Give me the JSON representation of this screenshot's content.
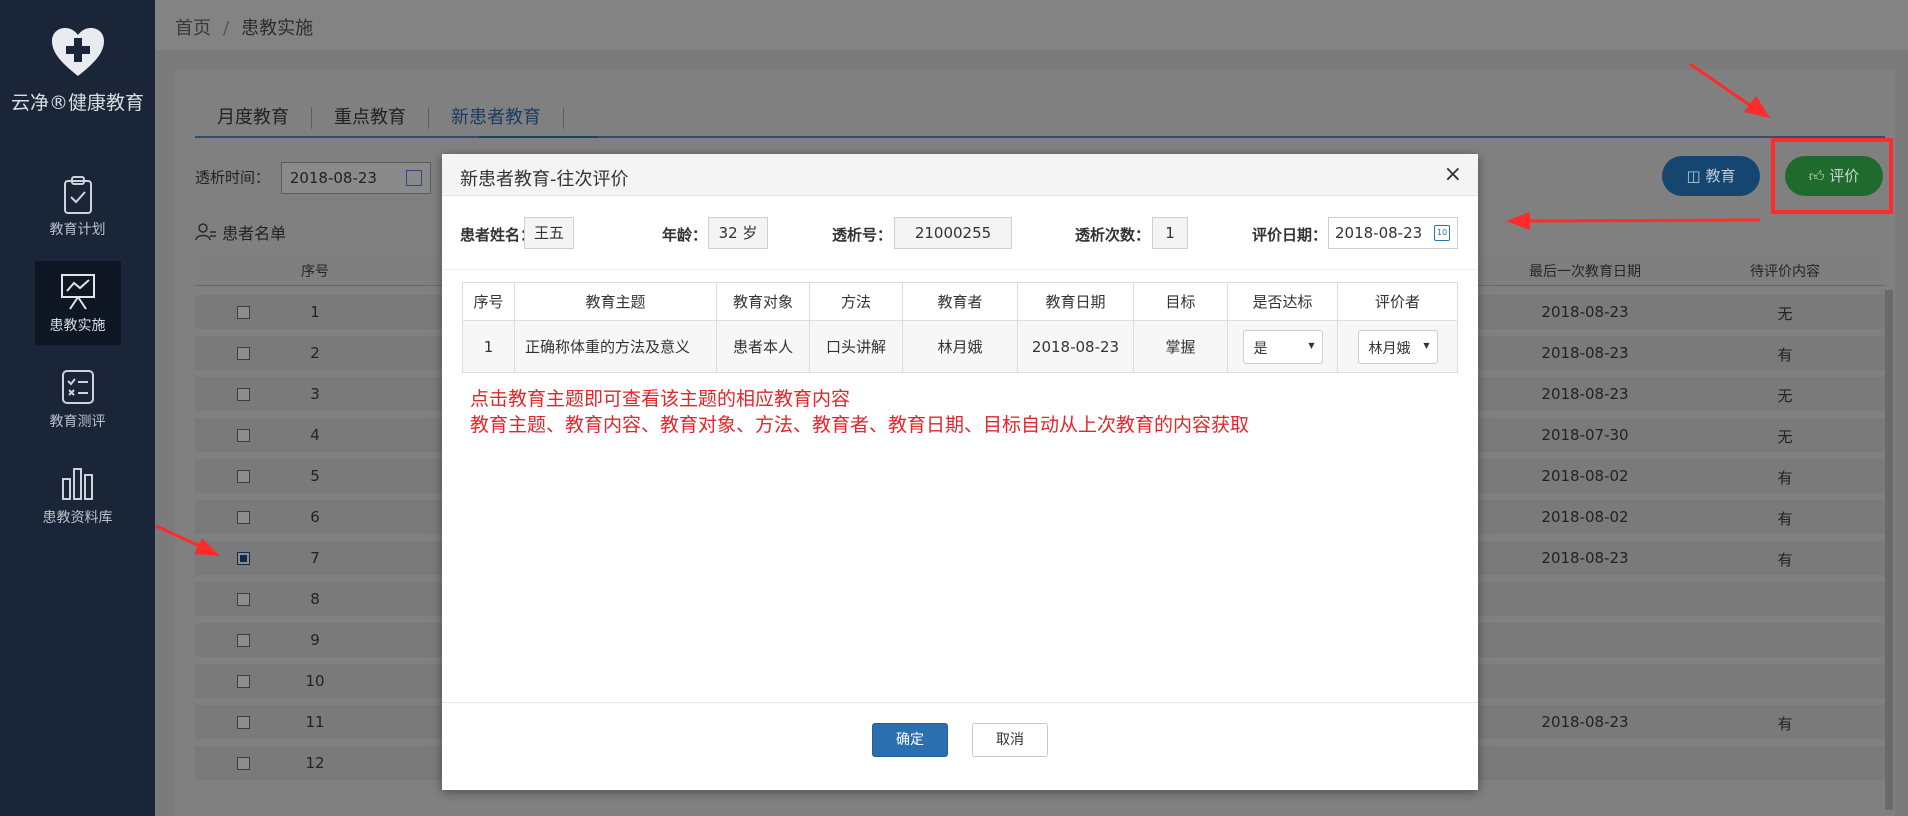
{
  "app": {
    "logo_text": "云净®健康教育"
  },
  "sidebar": {
    "items": [
      {
        "label": "教育计划",
        "icon": "clipboard-check-icon",
        "active": false
      },
      {
        "label": "患教实施",
        "icon": "presentation-board-icon",
        "active": true
      },
      {
        "label": "教育测评",
        "icon": "checklist-icon",
        "active": false
      },
      {
        "label": "患教资料库",
        "icon": "books-icon",
        "active": false
      }
    ]
  },
  "breadcrumb": {
    "home": "首页",
    "separator": "/",
    "current": "患教实施"
  },
  "tabs": [
    "月度教育",
    "重点教育",
    "新患者教育"
  ],
  "filter": {
    "label": "透析时间：",
    "date": "2018-08-23"
  },
  "list_title": "患者名单",
  "actions": {
    "edu_label": "教育",
    "eval_label": "评价"
  },
  "table": {
    "headers": {
      "seq": "序号",
      "last_date": "最后一次教育日期",
      "pending": "待评价内容"
    },
    "rows": [
      {
        "seq": "1",
        "last_date": "2018-08-23",
        "pending": "无",
        "checked": false
      },
      {
        "seq": "2",
        "last_date": "2018-08-23",
        "pending": "有",
        "checked": false
      },
      {
        "seq": "3",
        "last_date": "2018-08-23",
        "pending": "无",
        "checked": false
      },
      {
        "seq": "4",
        "last_date": "2018-07-30",
        "pending": "无",
        "checked": false
      },
      {
        "seq": "5",
        "last_date": "2018-08-02",
        "pending": "有",
        "checked": false
      },
      {
        "seq": "6",
        "last_date": "2018-08-02",
        "pending": "有",
        "checked": false
      },
      {
        "seq": "7",
        "last_date": "2018-08-23",
        "pending": "有",
        "checked": true
      },
      {
        "seq": "8",
        "last_date": "",
        "pending": "",
        "checked": false
      },
      {
        "seq": "9",
        "last_date": "",
        "pending": "",
        "checked": false
      },
      {
        "seq": "10",
        "last_date": "",
        "pending": "",
        "checked": false
      },
      {
        "seq": "11",
        "last_date": "2018-08-23",
        "pending": "有",
        "checked": false
      },
      {
        "seq": "12",
        "last_date": "",
        "pending": "",
        "checked": false
      }
    ]
  },
  "modal": {
    "title": "新患者教育-往次评价",
    "close_glyph": "×",
    "fields": {
      "name_label": "患者姓名：",
      "name": "王五",
      "age_label": "年龄：",
      "age": "32 岁",
      "dialysis_no_label": "透析号：",
      "dialysis_no": "21000255",
      "dialysis_count_label": "透析次数：",
      "dialysis_count": "1",
      "eval_date_label": "评价日期：",
      "eval_date": "2018-08-23"
    },
    "grid": {
      "headers": [
        "序号",
        "教育主题",
        "教育对象",
        "方法",
        "教育者",
        "教育日期",
        "目标",
        "是否达标",
        "评价者"
      ],
      "rows": [
        {
          "seq": "1",
          "topic": "正确称体重的方法及意义",
          "target": "患者本人",
          "method": "口头讲解",
          "educator": "林月娥",
          "date": "2018-08-23",
          "goal": "掌握",
          "achieved": "是",
          "evaluator": "林月娥"
        }
      ]
    },
    "note_lines": [
      "点击教育主题即可查看该主题的相应教育内容",
      "教育主题、教育内容、教育对象、方法、教育者、教育日期、目标自动从上次教育的内容获取"
    ],
    "ok_label": "确定",
    "cancel_label": "取消"
  },
  "colors": {
    "annotation_red": "#ff2a2a",
    "primary_blue": "#2b6fb0",
    "eval_green": "#1f6b2d"
  }
}
